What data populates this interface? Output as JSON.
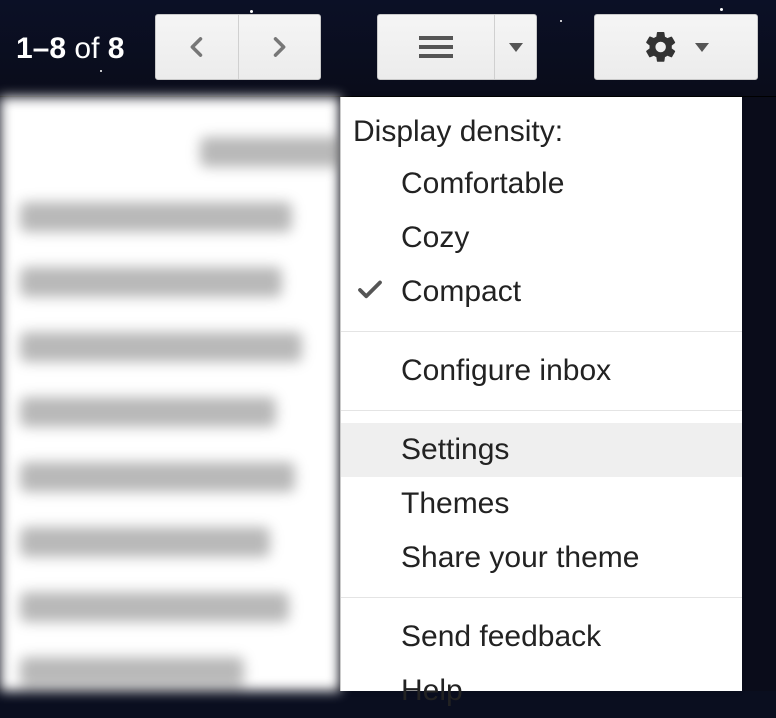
{
  "toolbar": {
    "count_prefix": "1–8",
    "count_of": " of ",
    "count_total": "8"
  },
  "menu": {
    "header": "Display density:",
    "density": {
      "comfortable": "Comfortable",
      "cozy": "Cozy",
      "compact": "Compact",
      "selected": "compact"
    },
    "configure_inbox": "Configure inbox",
    "settings": "Settings",
    "themes": "Themes",
    "share_theme": "Share your theme",
    "send_feedback": "Send feedback",
    "help": "Help",
    "highlighted": "settings"
  }
}
